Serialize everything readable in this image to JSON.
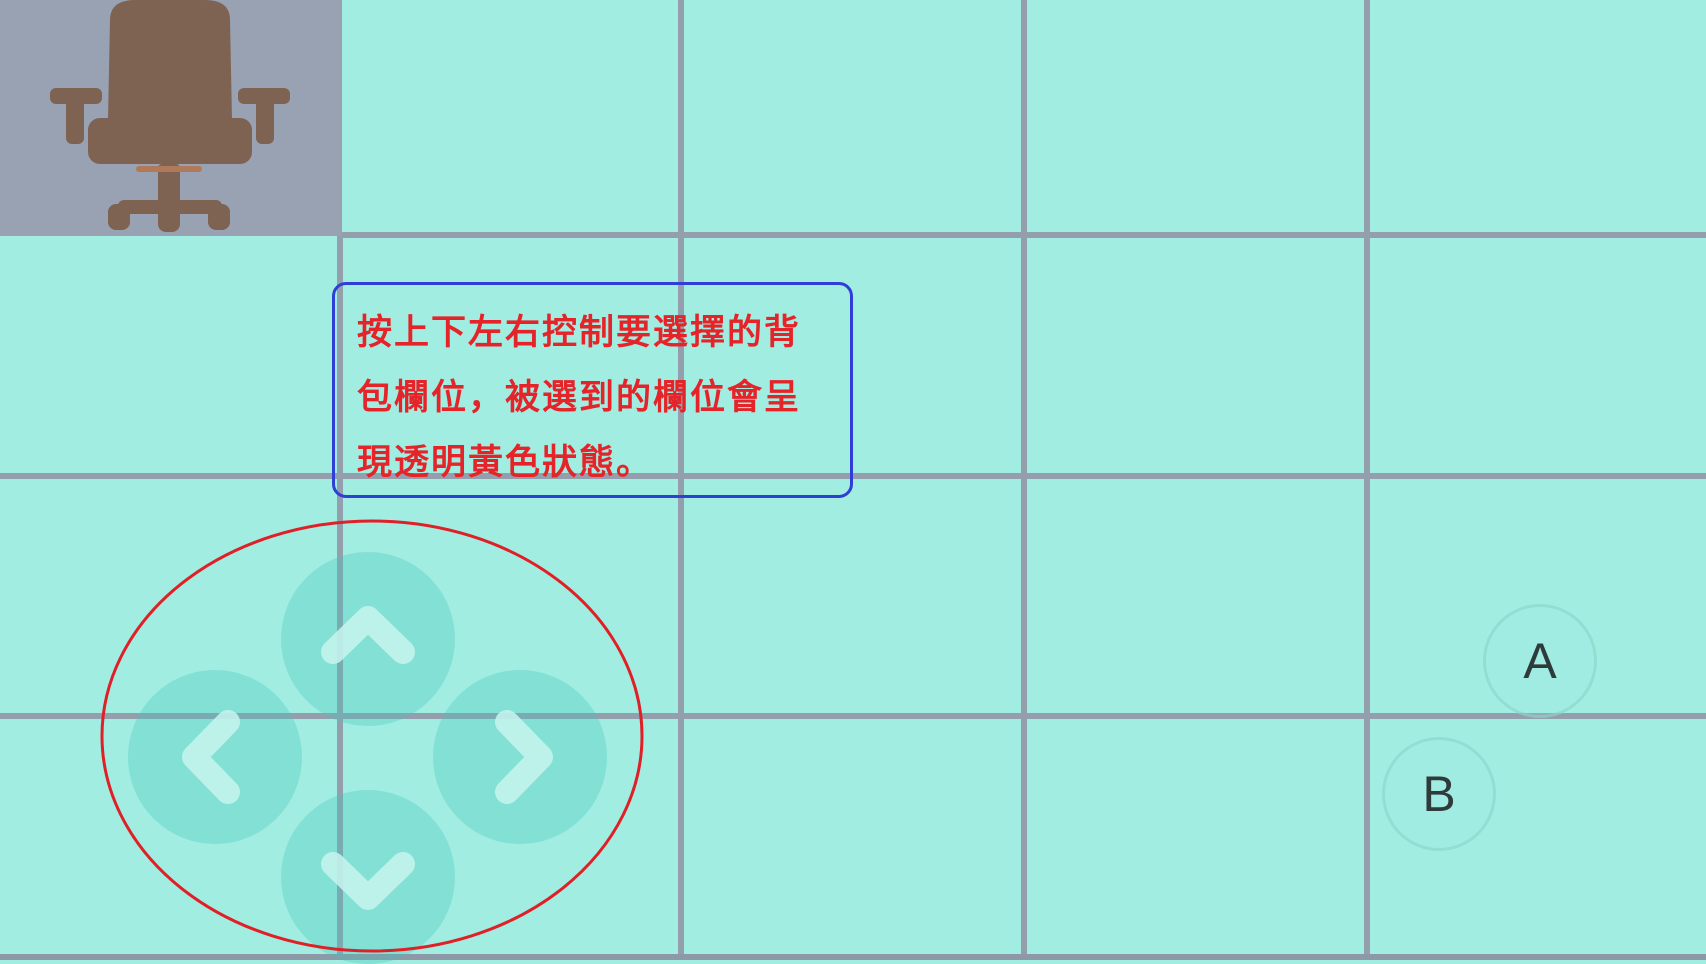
{
  "inventory": {
    "rows": 4,
    "cols": 5,
    "selected_cell": {
      "row": 1,
      "col": 1
    },
    "items": [
      {
        "row": 1,
        "col": 1,
        "icon": "office-chair-icon"
      }
    ]
  },
  "tooltip": {
    "text": "按上下左右控制要選擇的背包欄位，被選到的欄位會呈現透明黃色狀態。"
  },
  "controls": {
    "dpad": {
      "up_icon": "chevron-up-icon",
      "down_icon": "chevron-down-icon",
      "left_icon": "chevron-left-icon",
      "right_icon": "chevron-right-icon"
    },
    "buttons": {
      "a_label": "A",
      "b_label": "B"
    }
  },
  "colors": {
    "cell_background": "#a2ede2",
    "grid_lines": "#949fae",
    "selected_cell": "#98a2b3",
    "chair": "#7e6353",
    "note_border": "#2f3fd6",
    "note_text": "#e5242a",
    "highlight_ellipse": "#e02027"
  }
}
